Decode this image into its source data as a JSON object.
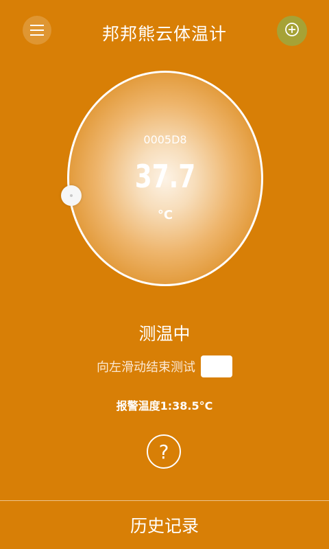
{
  "header": {
    "title": "邦邦熊云体温计",
    "menu_icon": "menu-icon",
    "add_icon": "add-device-icon",
    "add_button_color": "#a6a236"
  },
  "dial": {
    "device_id": "0005D8",
    "temperature": "37.7",
    "unit": "°C"
  },
  "status": {
    "text": "测温中",
    "swipe_label": "向左滑动结束测试",
    "alarm_text": "报警温度1:38.5°C",
    "help_symbol": "?"
  },
  "footer": {
    "history_label": "历史记录"
  },
  "colors": {
    "background": "#d87f06",
    "text": "#ffffff"
  }
}
